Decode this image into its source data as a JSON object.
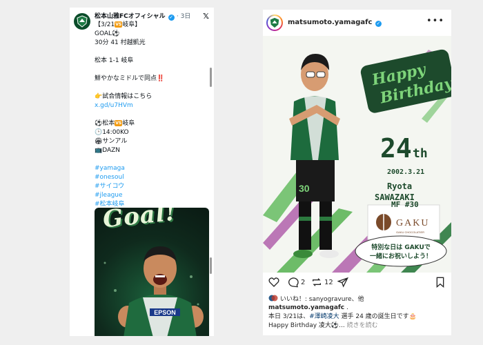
{
  "x_post": {
    "account_name": "松本山雅FCオフィシャル",
    "time": "· 3日",
    "lines": [
      {
        "text": "【3/21",
        "vs": "VS",
        "after": "岐阜】"
      },
      {
        "text": "GOAL⚽"
      },
      {
        "text": "30分 41 村越凱光"
      },
      {
        "text": ""
      },
      {
        "text": "松本 1-1 岐阜"
      },
      {
        "text": ""
      },
      {
        "text": "鮮やかなミドルで同点‼️"
      },
      {
        "text": ""
      },
      {
        "text": "👉試合情報はこちら"
      },
      {
        "text": "x.gd/u7HVm",
        "link": true
      },
      {
        "text": ""
      },
      {
        "text": "⚽松本",
        "vs": "VS",
        "after": "岐阜"
      },
      {
        "text": "🕒14:00KO"
      },
      {
        "text": "🏟サンアル"
      },
      {
        "text": "📺DAZN"
      },
      {
        "text": ""
      },
      {
        "text": "#yamaga",
        "link": true
      },
      {
        "text": "#onesoul",
        "link": true
      },
      {
        "text": "#サイコウ",
        "link": true
      },
      {
        "text": "#jleague",
        "link": true
      },
      {
        "text": "#松本岐阜",
        "link": true
      }
    ],
    "image_title": "Goal!",
    "shirt_sponsor": "EPSON"
  },
  "instagram_post": {
    "username": "matsumoto.yamagafc",
    "graphic": {
      "banner": "Happy Birthday",
      "age_number": "24",
      "age_suffix": "th",
      "birthdate": "2002.3.21",
      "first_name": "Ryota",
      "last_name": "SAWAZAKI",
      "position": "MF #30",
      "jersey_number": "30",
      "sponsor_name": "GAKU",
      "sponsor_sub": "GAKU CHOCOLATIER",
      "bubble_line1": "特別な日は GAKUで",
      "bubble_line2": "一緒にお祝いしよう！"
    },
    "comments_count": "2",
    "reposts_count": "12",
    "likes_text": "いいね！: sanyogravure、他",
    "caption_user": "matsumoto.yamagafc",
    "caption_after_user": " .",
    "caption_line3_prefix": "本日 3/21は、",
    "caption_line3_tag": "#澤崎凌大",
    "caption_line3_suffix": " 選手 24 歳の誕生日です🎂",
    "caption_line4": "Happy Birthday 凌大⚽...",
    "caption_more": " 続きを読む"
  },
  "colors": {
    "brand_green": "#0b4d2a",
    "link_blue": "#1d9bf0",
    "ig_link": "#00376b"
  }
}
